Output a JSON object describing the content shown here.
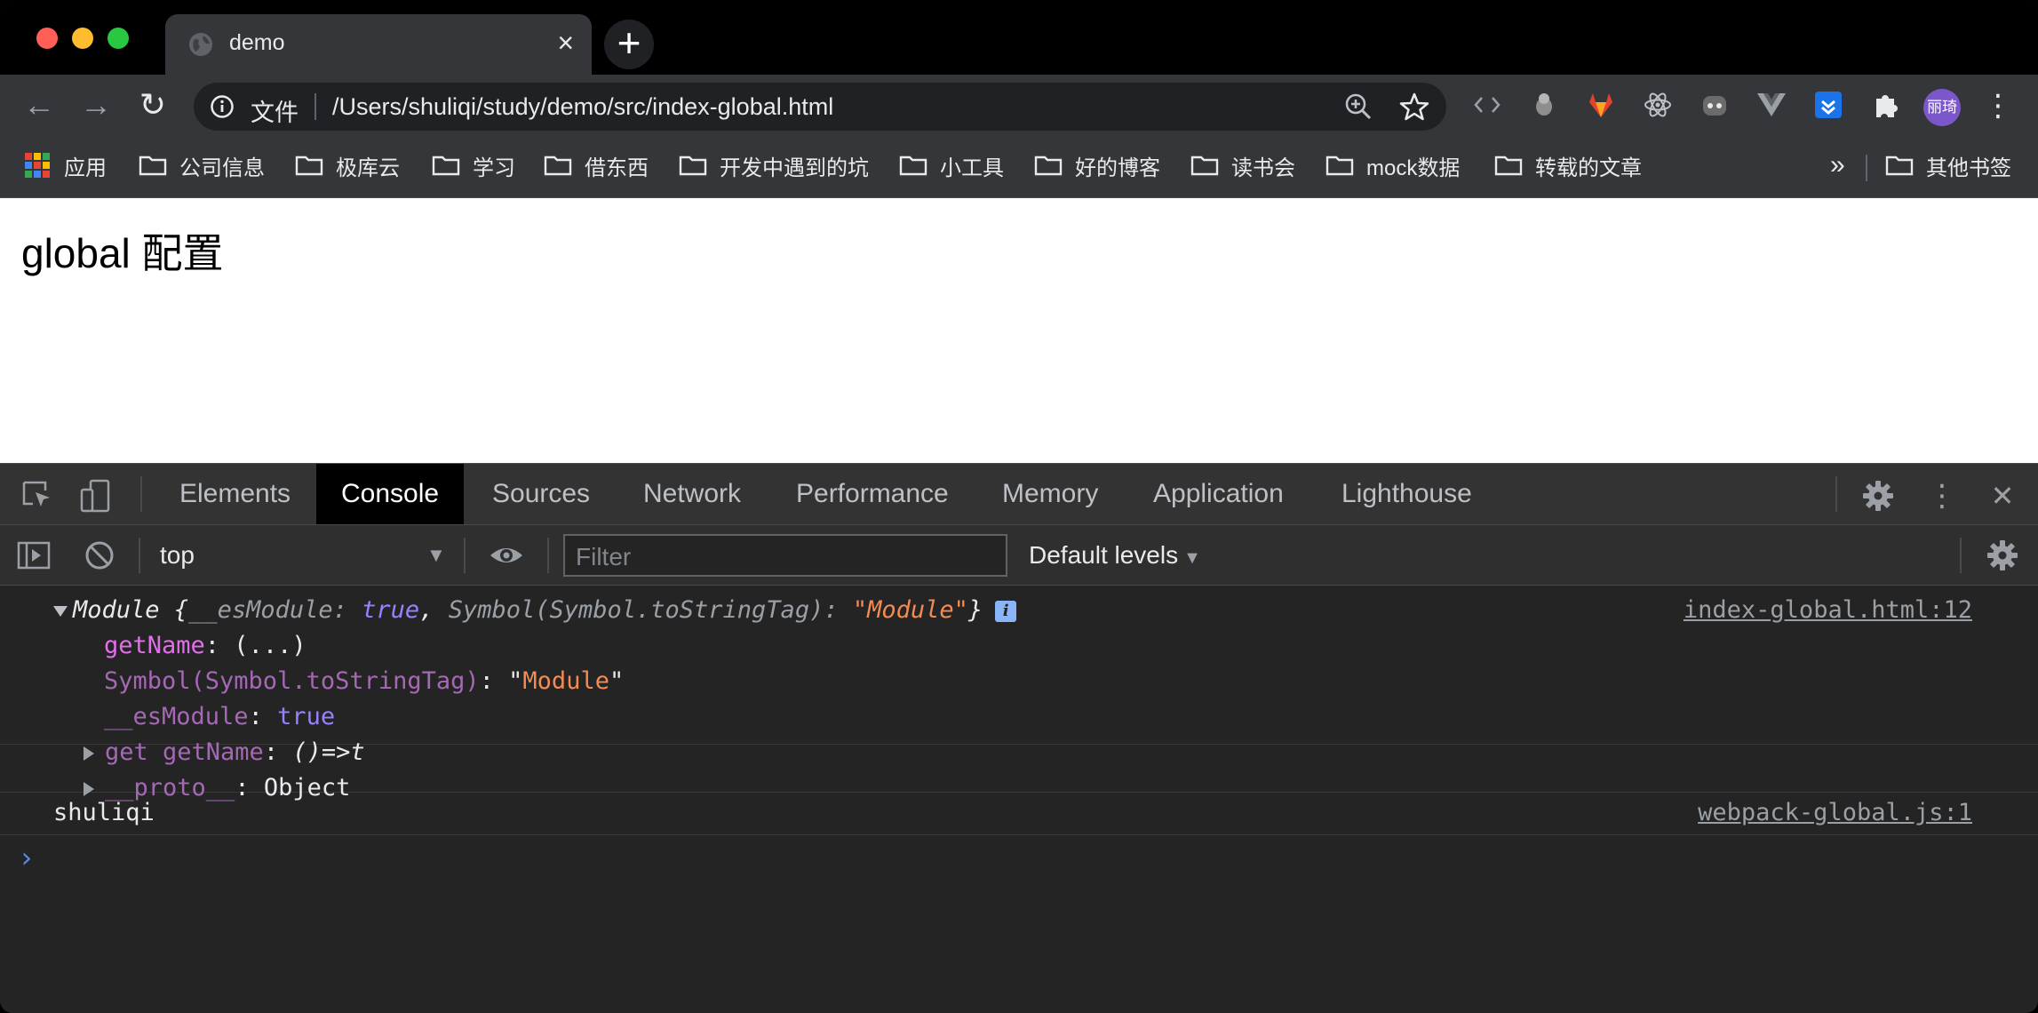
{
  "browser": {
    "tab_title": "demo",
    "tab_close": "×",
    "new_tab": "+",
    "scheme_label": "文件",
    "url": "/Users/shuliqi/study/demo/src/index-global.html",
    "avatar_text": "丽琦",
    "menu_glyph": "⋮",
    "back_glyph": "←",
    "forward_glyph": "→",
    "reload_glyph": "↻"
  },
  "bookmarks": {
    "apps_label": "应用",
    "folders": [
      "公司信息",
      "极库云",
      "学习",
      "借东西",
      "开发中遇到的坑",
      "小工具",
      "好的博客",
      "读书会",
      "mock数据",
      "转载的文章"
    ],
    "more_glyph": "»",
    "other_label": "其他书签"
  },
  "page": {
    "heading": "global 配置"
  },
  "devtools": {
    "tabs": [
      "Elements",
      "Console",
      "Sources",
      "Network",
      "Performance",
      "Memory",
      "Application",
      "Lighthouse"
    ],
    "active_tab": "Console",
    "context": "top",
    "context_arrow": "▼",
    "filter_placeholder": "Filter",
    "levels_label": "Default levels",
    "levels_arrow": "▼",
    "close_glyph": "✕",
    "more_glyph": "⋮"
  },
  "console": {
    "entry1": {
      "summary_name": "Module",
      "summary_open": " {",
      "summary_k1": "__esModule",
      "summary_colon1": ": ",
      "summary_v1": "true",
      "summary_comma": ", ",
      "summary_k2": "Symbol(Symbol.toStringTag)",
      "summary_colon2": ": ",
      "summary_v2": "\"Module\"",
      "summary_close": "}",
      "info_badge": "i",
      "source": "index-global.html:12",
      "prop1_key": "getName",
      "prop1_val": ": (...)",
      "prop2_key": "Symbol(Symbol.toStringTag)",
      "prop2_colon": ": ",
      "prop2_q1": "\"",
      "prop2_val": "Module",
      "prop2_q2": "\"",
      "prop3_key": "__esModule",
      "prop3_colon": ": ",
      "prop3_val": "true",
      "prop4_key": "get getName",
      "prop4_colon": ": ",
      "prop4_val": "()=>t",
      "prop5_key": "__proto__",
      "prop5_colon": ": ",
      "prop5_val": "Object"
    },
    "entry2": {
      "text": "shuliqi",
      "source": "webpack-global.js:1"
    },
    "prompt": "›"
  }
}
